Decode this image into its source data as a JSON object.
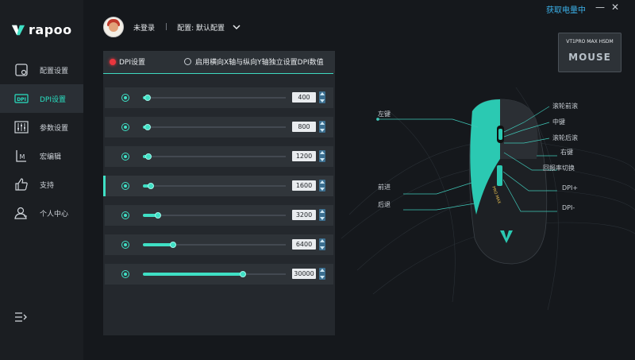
{
  "topbar": {
    "battery_label": "获取电量中",
    "minimize": "—",
    "close": "✕"
  },
  "brand": {
    "logo_text": "rapoo"
  },
  "sidebar": {
    "items": [
      {
        "label": "配置设置",
        "icon": "config-icon"
      },
      {
        "label": "DPI设置",
        "icon": "dpi-icon"
      },
      {
        "label": "参数设置",
        "icon": "params-icon"
      },
      {
        "label": "宏编辑",
        "icon": "macro-icon"
      },
      {
        "label": "支持",
        "icon": "thumbs-up-icon"
      },
      {
        "label": "个人中心",
        "icon": "user-icon"
      }
    ],
    "active_index": 1
  },
  "header": {
    "user": "未登录",
    "separator": "|",
    "profile": "配置: 默认配置"
  },
  "dpi_panel": {
    "tab_label": "DPI设置",
    "option_label": "启用横向X轴与纵向Y轴独立设置DPI数值",
    "max_dpi": 30000,
    "active_row": 3,
    "rows": [
      {
        "value": "400",
        "level": 400
      },
      {
        "value": "800",
        "level": 800
      },
      {
        "value": "1200",
        "level": 1200
      },
      {
        "value": "1600",
        "level": 1600
      },
      {
        "value": "3200",
        "level": 3200
      },
      {
        "value": "6400",
        "level": 6400
      },
      {
        "value": "30000",
        "level": 30000
      }
    ]
  },
  "device": {
    "model": "VT1PRO MAX HSDM",
    "type": "MOUSE",
    "mouse_text": "PRO MAX"
  },
  "callouts": {
    "left_click": "左键",
    "scroll_up": "滚轮前滚",
    "middle": "中键",
    "scroll_down": "滚轮后滚",
    "right_click": "右键",
    "report_rate": "回报率切换",
    "forward": "前进",
    "dpi_plus": "DPI+",
    "back": "后退",
    "dpi_minus": "DPI-"
  },
  "colors": {
    "accent": "#3fe0c5",
    "active_red": "#e9363e",
    "battery_link": "#3bb0e8"
  }
}
